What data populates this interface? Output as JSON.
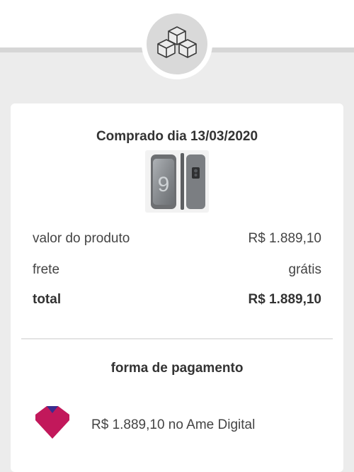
{
  "header": {
    "icon": "boxes-icon"
  },
  "order": {
    "purchase_date_label": "Comprado dia 13/03/2020",
    "product_image": "smartphone-image",
    "rows": [
      {
        "label": "valor do produto",
        "value": "R$ 1.889,10"
      },
      {
        "label": "frete",
        "value": "grátis"
      },
      {
        "label": "total",
        "value": "R$ 1.889,10"
      }
    ]
  },
  "payment": {
    "title": "forma de pagamento",
    "method_icon": "ame-digital-logo",
    "description": "R$ 1.889,10 no Ame Digital"
  },
  "colors": {
    "ame_brand": "#c2185b",
    "ame_accent": "#3a2d8f"
  }
}
